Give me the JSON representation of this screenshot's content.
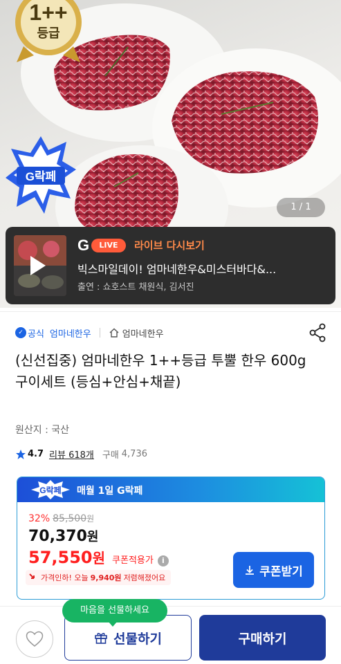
{
  "hero": {
    "grade_badge_top": "1++",
    "grade_badge_bottom": "등급",
    "promo_badge": "G락페",
    "image_counter": "1 / 1"
  },
  "live": {
    "logo_letter": "G",
    "pill_label": "LIVE",
    "replay_label": "라이브 다시보기",
    "title": "빅스마일데이! 엄마네한우&미스터바다&...",
    "cast": "출연 : 쇼호스트 채원식, 김서진"
  },
  "brand": {
    "official_icon": "✓",
    "official_label": "공식",
    "brand_name": "엄마네한우",
    "shop_name": "엄마네한우"
  },
  "product": {
    "title": "(신선집중) 엄마네한우 1++등급 투뿔 한우 600g 구이세트 (등심+안심+채끝)",
    "origin": "원산지 : 국산",
    "rating": "4.7",
    "review_label": "리뷰 618개",
    "purchase_label": "구매",
    "purchase_count": "4,736"
  },
  "coupon": {
    "badge": "G락페",
    "header_text": "매월 1일 G락페",
    "discount_rate": "32%",
    "original_price": "85,500",
    "original_won": "원",
    "sale_price": "70,370",
    "sale_won": "원",
    "coupon_price": "57,550",
    "coupon_won": "원",
    "coupon_applied_label": "쿠폰적용가",
    "info_icon": "i",
    "price_drop_prefix": "가격인하! 오늘",
    "price_drop_amount": "9,940원",
    "price_drop_suffix": "저렴해졌어요",
    "coupon_button": "쿠폰받기"
  },
  "bottom": {
    "tooltip": "마음을 선물하세요",
    "gift_button": "선물하기",
    "buy_button": "구매하기"
  },
  "colors": {
    "accent_blue": "#1b64e3",
    "navy": "#1f3b9a",
    "sale_red": "#ff1f1f",
    "tooltip_green": "#18b463",
    "live_orange": "#ff5b3a"
  },
  "icons": [
    "grade-badge-icon",
    "play-icon",
    "official-check-icon",
    "home-icon",
    "share-icon",
    "star-icon",
    "info-icon",
    "arrow-down-icon",
    "download-icon",
    "heart-icon",
    "gift-icon"
  ]
}
